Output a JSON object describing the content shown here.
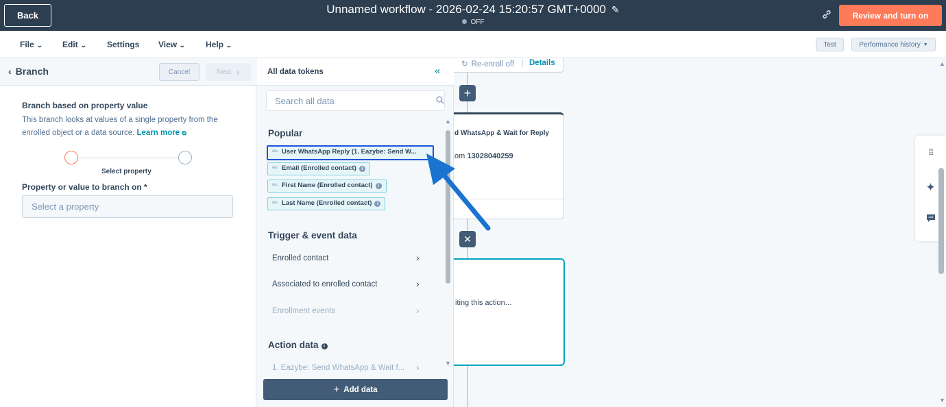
{
  "topbar": {
    "back_label": "Back",
    "workflow_title": "Unnamed workflow - 2026-02-24 15:20:57 GMT+0000",
    "status": "OFF",
    "review_label": "Review and turn on"
  },
  "menubar": {
    "items": [
      {
        "label": "File"
      },
      {
        "label": "Edit"
      },
      {
        "label": "Settings"
      },
      {
        "label": "View"
      },
      {
        "label": "Help"
      }
    ],
    "test_label": "Test",
    "performance_label": "Performance history"
  },
  "left_panel": {
    "title": "Branch",
    "cancel_label": "Cancel",
    "next_label": "Next",
    "section_heading": "Branch based on property value",
    "section_desc": "This branch looks at values of a single property from the enrolled object or a data source.",
    "learn_more": "Learn more",
    "step_label": "Select property",
    "property_label": "Property or value to branch on *",
    "property_placeholder": "Select a property"
  },
  "tokens_panel": {
    "title": "All data tokens",
    "search_placeholder": "Search all data",
    "popular_heading": "Popular",
    "popular_tokens": [
      {
        "label": "User WhatsApp Reply (1. Eazybe: Send W...",
        "has_info": false,
        "selected": true
      },
      {
        "label": "Email (Enrolled contact)",
        "has_info": true,
        "selected": false
      },
      {
        "label": "First Name (Enrolled contact)",
        "has_info": true,
        "selected": false
      },
      {
        "label": "Last Name (Enrolled contact)",
        "has_info": true,
        "selected": false
      }
    ],
    "trigger_heading": "Trigger & event data",
    "trigger_items": [
      {
        "label": "Enrolled contact",
        "faded": false
      },
      {
        "label": "Associated to enrolled contact",
        "faded": false
      },
      {
        "label": "Enrollment events",
        "faded": true
      }
    ],
    "action_heading": "Action data",
    "action_items": [
      {
        "label": "1. Eazybe: Send WhatsApp & Wait f..."
      }
    ],
    "add_data_label": "Add data"
  },
  "canvas": {
    "reenroll_label": "Re-enroll off",
    "details_label": "Details",
    "wa_node_title": "d WhatsApp & Wait for Reply",
    "wa_node_from_prefix": "om",
    "wa_node_from_number": "13028040259",
    "new_node_text": "iting this action..."
  }
}
